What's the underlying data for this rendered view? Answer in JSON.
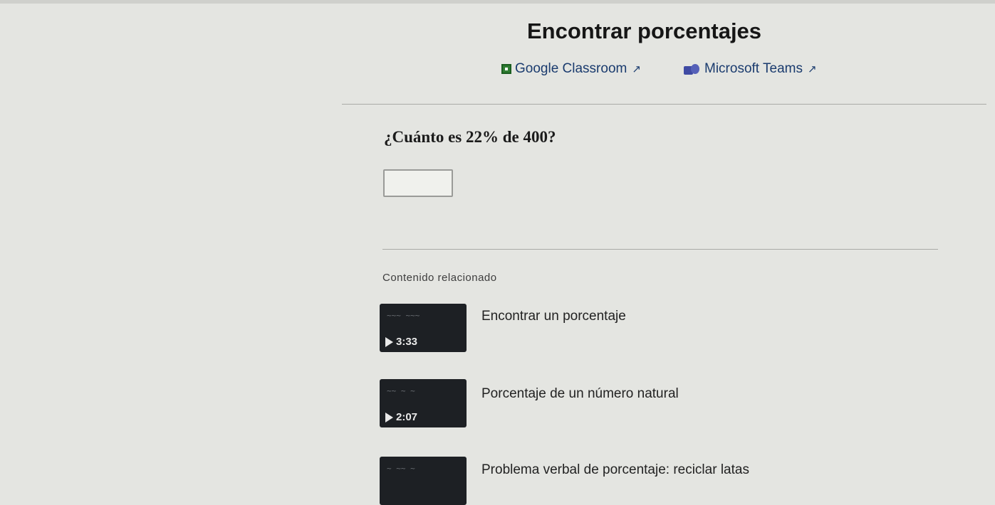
{
  "exercise": {
    "title": "Encontrar porcentajes",
    "question": "¿Cuánto es 22% de 400?",
    "answer_value": ""
  },
  "share": {
    "google_classroom": "Google Classroom",
    "microsoft_teams": "Microsoft Teams"
  },
  "related": {
    "heading": "Contenido relacionado",
    "items": [
      {
        "title": "Encontrar un porcentaje",
        "duration": "3:33"
      },
      {
        "title": "Porcentaje de un número natural",
        "duration": "2:07"
      },
      {
        "title": "Problema verbal de porcentaje: reciclar latas",
        "duration": ""
      }
    ]
  }
}
